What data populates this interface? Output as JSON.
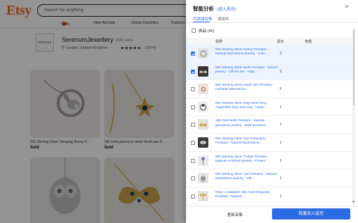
{
  "etsy": {
    "logo": "Etsy",
    "search_placeholder": "Search for anything",
    "nav": [
      "Gifts",
      "New Arrivals",
      "Home Favorites",
      "Fashion"
    ],
    "shop": {
      "box_text": "SERENUM",
      "name": "SerenumJewellery",
      "sales": "2435 Sales",
      "location": "London, United Kingdom",
      "stars": "★★★★★",
      "reviews": "(1074)"
    },
    "listings": [
      {
        "title": "925 Sterling Silver Sleeping Bunny P...",
        "status": "Sold"
      },
      {
        "title": "18k Gold plated on silver North star P...",
        "status": "Sold"
      }
    ]
  },
  "panel": {
    "title": "智能分析",
    "subtitle": "(进入后台)",
    "close_icon": "×",
    "tabs": [
      "可添加对象",
      "添加中"
    ],
    "select_all_label": "商品 (20)",
    "columns": [
      "名称",
      "显示",
      "标签"
    ],
    "items": [
      {
        "name": "925 Sterling Silver bunny Pendant - Natural Moonstone jewelry - Cele...",
        "count": "3",
        "checked": true
      },
      {
        "name": "925 Sterling Silver Moth Pendant - Garnet jewelry - Gift for her - Nigh...",
        "count": "2",
        "checked": true
      },
      {
        "name": "925 Sterling Silver North star Pendant - Celestial Moonstone...",
        "count": "2",
        "checked": false
      },
      {
        "name": "925 Sterling Silver Dog Nose Ring - Adjustable dog nose ring - Uniqu...",
        "count": "1",
        "checked": false
      },
      {
        "name": "18k Gold Moth Pendant - Kyanite gemstone jewelry - Moth pendant...",
        "count": "1",
        "checked": false
      },
      {
        "name": "925 Sterling Silver Eye Protection Pendant - Natural Moonstone...",
        "count": "1",
        "checked": false
      },
      {
        "name": "925 Sterling Silver Thistle Pendant - Natural Amethyst jewelry - Flower...",
        "count": "1",
        "checked": false
      },
      {
        "name": "925 Sterling Silver Owl Pendant - Natural Moonstone jewelry - Gift...",
        "count": "1",
        "checked": false
      },
      {
        "name": "Only 1 Available! 18k Gold Dragonfly Pendant - Natural...",
        "count": "1",
        "checked": false
      }
    ],
    "scroll_down_icon": "▼",
    "footer": {
      "left_button": "重新采集",
      "right_button": "批量加入监控"
    }
  },
  "colors": {
    "accent": "#2d6be4",
    "etsy_orange": "#f1641e"
  }
}
